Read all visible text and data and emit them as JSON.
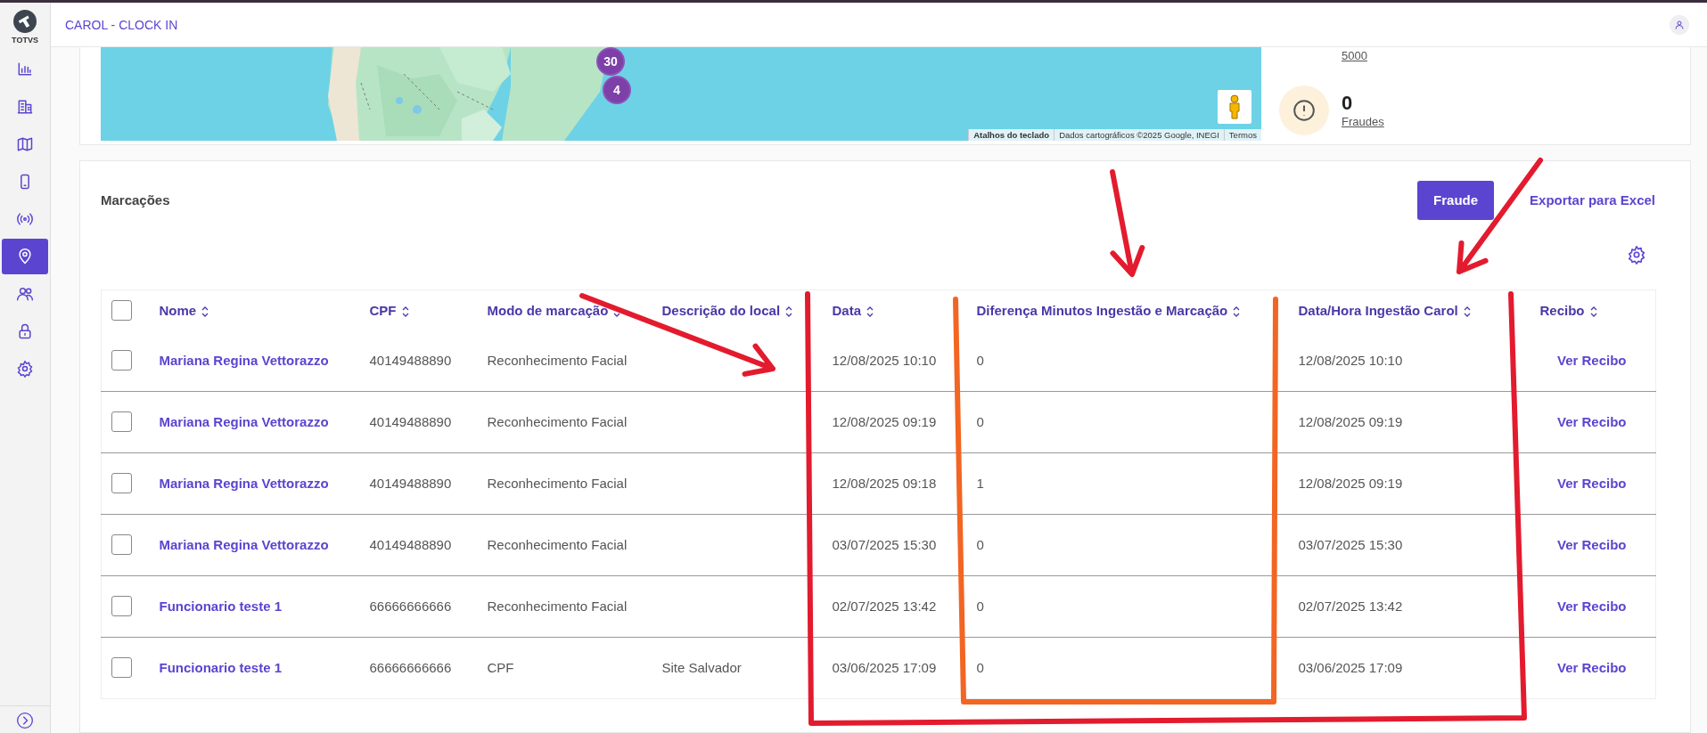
{
  "app": {
    "logo": "TOTVS",
    "title": "CAROL - CLOCK IN"
  },
  "sidebar": {
    "items": [
      {
        "kind": "chart",
        "selected": false
      },
      {
        "kind": "building",
        "selected": false
      },
      {
        "kind": "map",
        "selected": false
      },
      {
        "kind": "phone",
        "selected": false
      },
      {
        "kind": "broadcast",
        "selected": false
      },
      {
        "kind": "pin",
        "selected": true
      },
      {
        "kind": "people",
        "selected": false
      },
      {
        "kind": "lock",
        "selected": false
      },
      {
        "kind": "gear",
        "selected": false
      }
    ]
  },
  "map": {
    "kind": "picture",
    "markers": [
      {
        "label": "30"
      },
      {
        "label": "4"
      }
    ],
    "attribution": [
      "Atalhos do teclado",
      "Dados cartográficos ©2025 Google, INEGI",
      "Termos"
    ]
  },
  "stats": [
    {
      "label": "5000"
    },
    {
      "value": "0",
      "label": "Fraudes"
    }
  ],
  "markings": {
    "title": "Marcações",
    "fraud_button": "Fraude",
    "export_link": "Exportar para Excel",
    "table": {
      "all_checked": false,
      "columns": [
        "Nome",
        "CPF",
        "Modo de marcação",
        "Descrição do local",
        "Data",
        "Diferença Minutos Ingestão e Marcação",
        "Data/Hora Ingestão Carol",
        "Recibo"
      ],
      "rows": [
        {
          "checked": false,
          "cells": [
            "Mariana Regina Vettorazzo",
            "40149488890",
            "Reconhecimento Facial",
            "",
            "12/08/2025 10:10",
            "0",
            "12/08/2025 10:10",
            "Ver Recibo"
          ]
        },
        {
          "checked": false,
          "cells": [
            "Mariana Regina Vettorazzo",
            "40149488890",
            "Reconhecimento Facial",
            "",
            "12/08/2025 09:19",
            "0",
            "12/08/2025 09:19",
            "Ver Recibo"
          ]
        },
        {
          "checked": false,
          "cells": [
            "Mariana Regina Vettorazzo",
            "40149488890",
            "Reconhecimento Facial",
            "",
            "12/08/2025 09:18",
            "1",
            "12/08/2025 09:19",
            "Ver Recibo"
          ]
        },
        {
          "checked": false,
          "cells": [
            "Mariana Regina Vettorazzo",
            "40149488890",
            "Reconhecimento Facial",
            "",
            "03/07/2025 15:30",
            "0",
            "03/07/2025 15:30",
            "Ver Recibo"
          ]
        },
        {
          "checked": false,
          "cells": [
            "Funcionario teste 1",
            "66666666666",
            "Reconhecimento Facial",
            "",
            "02/07/2025 13:42",
            "0",
            "02/07/2025 13:42",
            "Ver Recibo"
          ]
        },
        {
          "checked": false,
          "cells": [
            "Funcionario teste 1",
            "66666666666",
            "CPF",
            "Site Salvador",
            "03/06/2025 17:09",
            "0",
            "03/06/2025 17:09",
            "Ver Recibo"
          ]
        }
      ]
    }
  },
  "annotations": [
    {
      "kind": "arrow",
      "color": "#e31b2e"
    },
    {
      "kind": "arrow",
      "color": "#e31b2e"
    },
    {
      "kind": "arrow",
      "color": "#e31b2e"
    },
    {
      "kind": "frame",
      "color": "#e31b2e"
    },
    {
      "kind": "frame",
      "color": "#f26522"
    }
  ]
}
